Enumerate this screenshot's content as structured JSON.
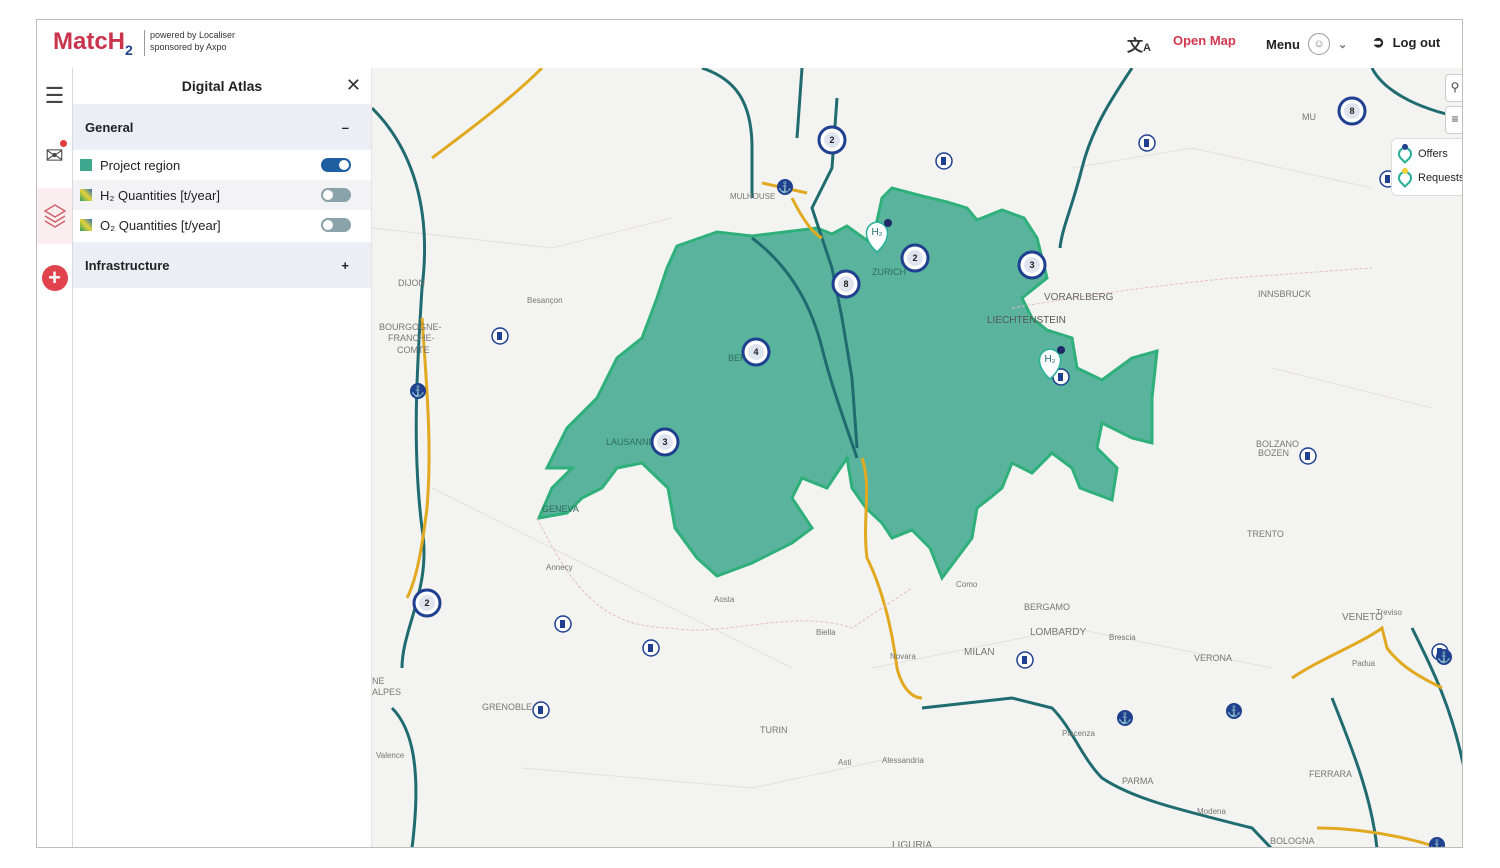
{
  "header": {
    "logo_main": "MatcH",
    "logo_sub": "2",
    "tagline_1": "powered by Localiser",
    "tagline_2": "sponsored by Axpo",
    "translate_icon": "translate-icon",
    "open_map_label": "Open Map",
    "menu_label": "Menu",
    "logout_label": "Log out"
  },
  "panel": {
    "title": "Digital Atlas",
    "sections": [
      {
        "label": "General",
        "toggle": "–"
      },
      {
        "label": "Infrastructure",
        "toggle": "+"
      }
    ],
    "layers": [
      {
        "label": "Project region",
        "on": true
      },
      {
        "label": "H₂ Quantities [t/year]",
        "on": false
      },
      {
        "label": "O₂ Quantities [t/year]",
        "on": false
      }
    ]
  },
  "legend": {
    "offers": "Offers",
    "requests": "Requests",
    "offers_color": "#1f3f8f",
    "requests_color": "#f2d23a"
  },
  "map": {
    "labels": [
      "MULHOUSE",
      "DIJON",
      "Besançon",
      "BOURGOGNE-",
      "FRANCHE-",
      "COMTE",
      "ZURICH",
      "BERN",
      "LAUSANNE",
      "GENEVA",
      "VORARLBERG",
      "LIECHTENSTEIN",
      "INNSBRUCK",
      "BOLZANO",
      "BOZEN",
      "TRENTO",
      "Annecy",
      "Aosta",
      "Biella",
      "Novara",
      "Como",
      "BERGAMO",
      "LOMBARDY",
      "Brescia",
      "MILAN",
      "VERONA",
      "VENETO",
      "Treviso",
      "Padua",
      "TURIN",
      "Asti",
      "Alessandria",
      "Piacenza",
      "PARMA",
      "FERRARA",
      "Modena",
      "BOLOGNA",
      "LIGURIA",
      "GRENOBLE",
      "Valence",
      "MU",
      "NE",
      "ALPES"
    ],
    "clusters": [
      "2",
      "2",
      "8",
      "3",
      "4",
      "3",
      "2",
      "8"
    ],
    "h2_label": "H₂"
  }
}
